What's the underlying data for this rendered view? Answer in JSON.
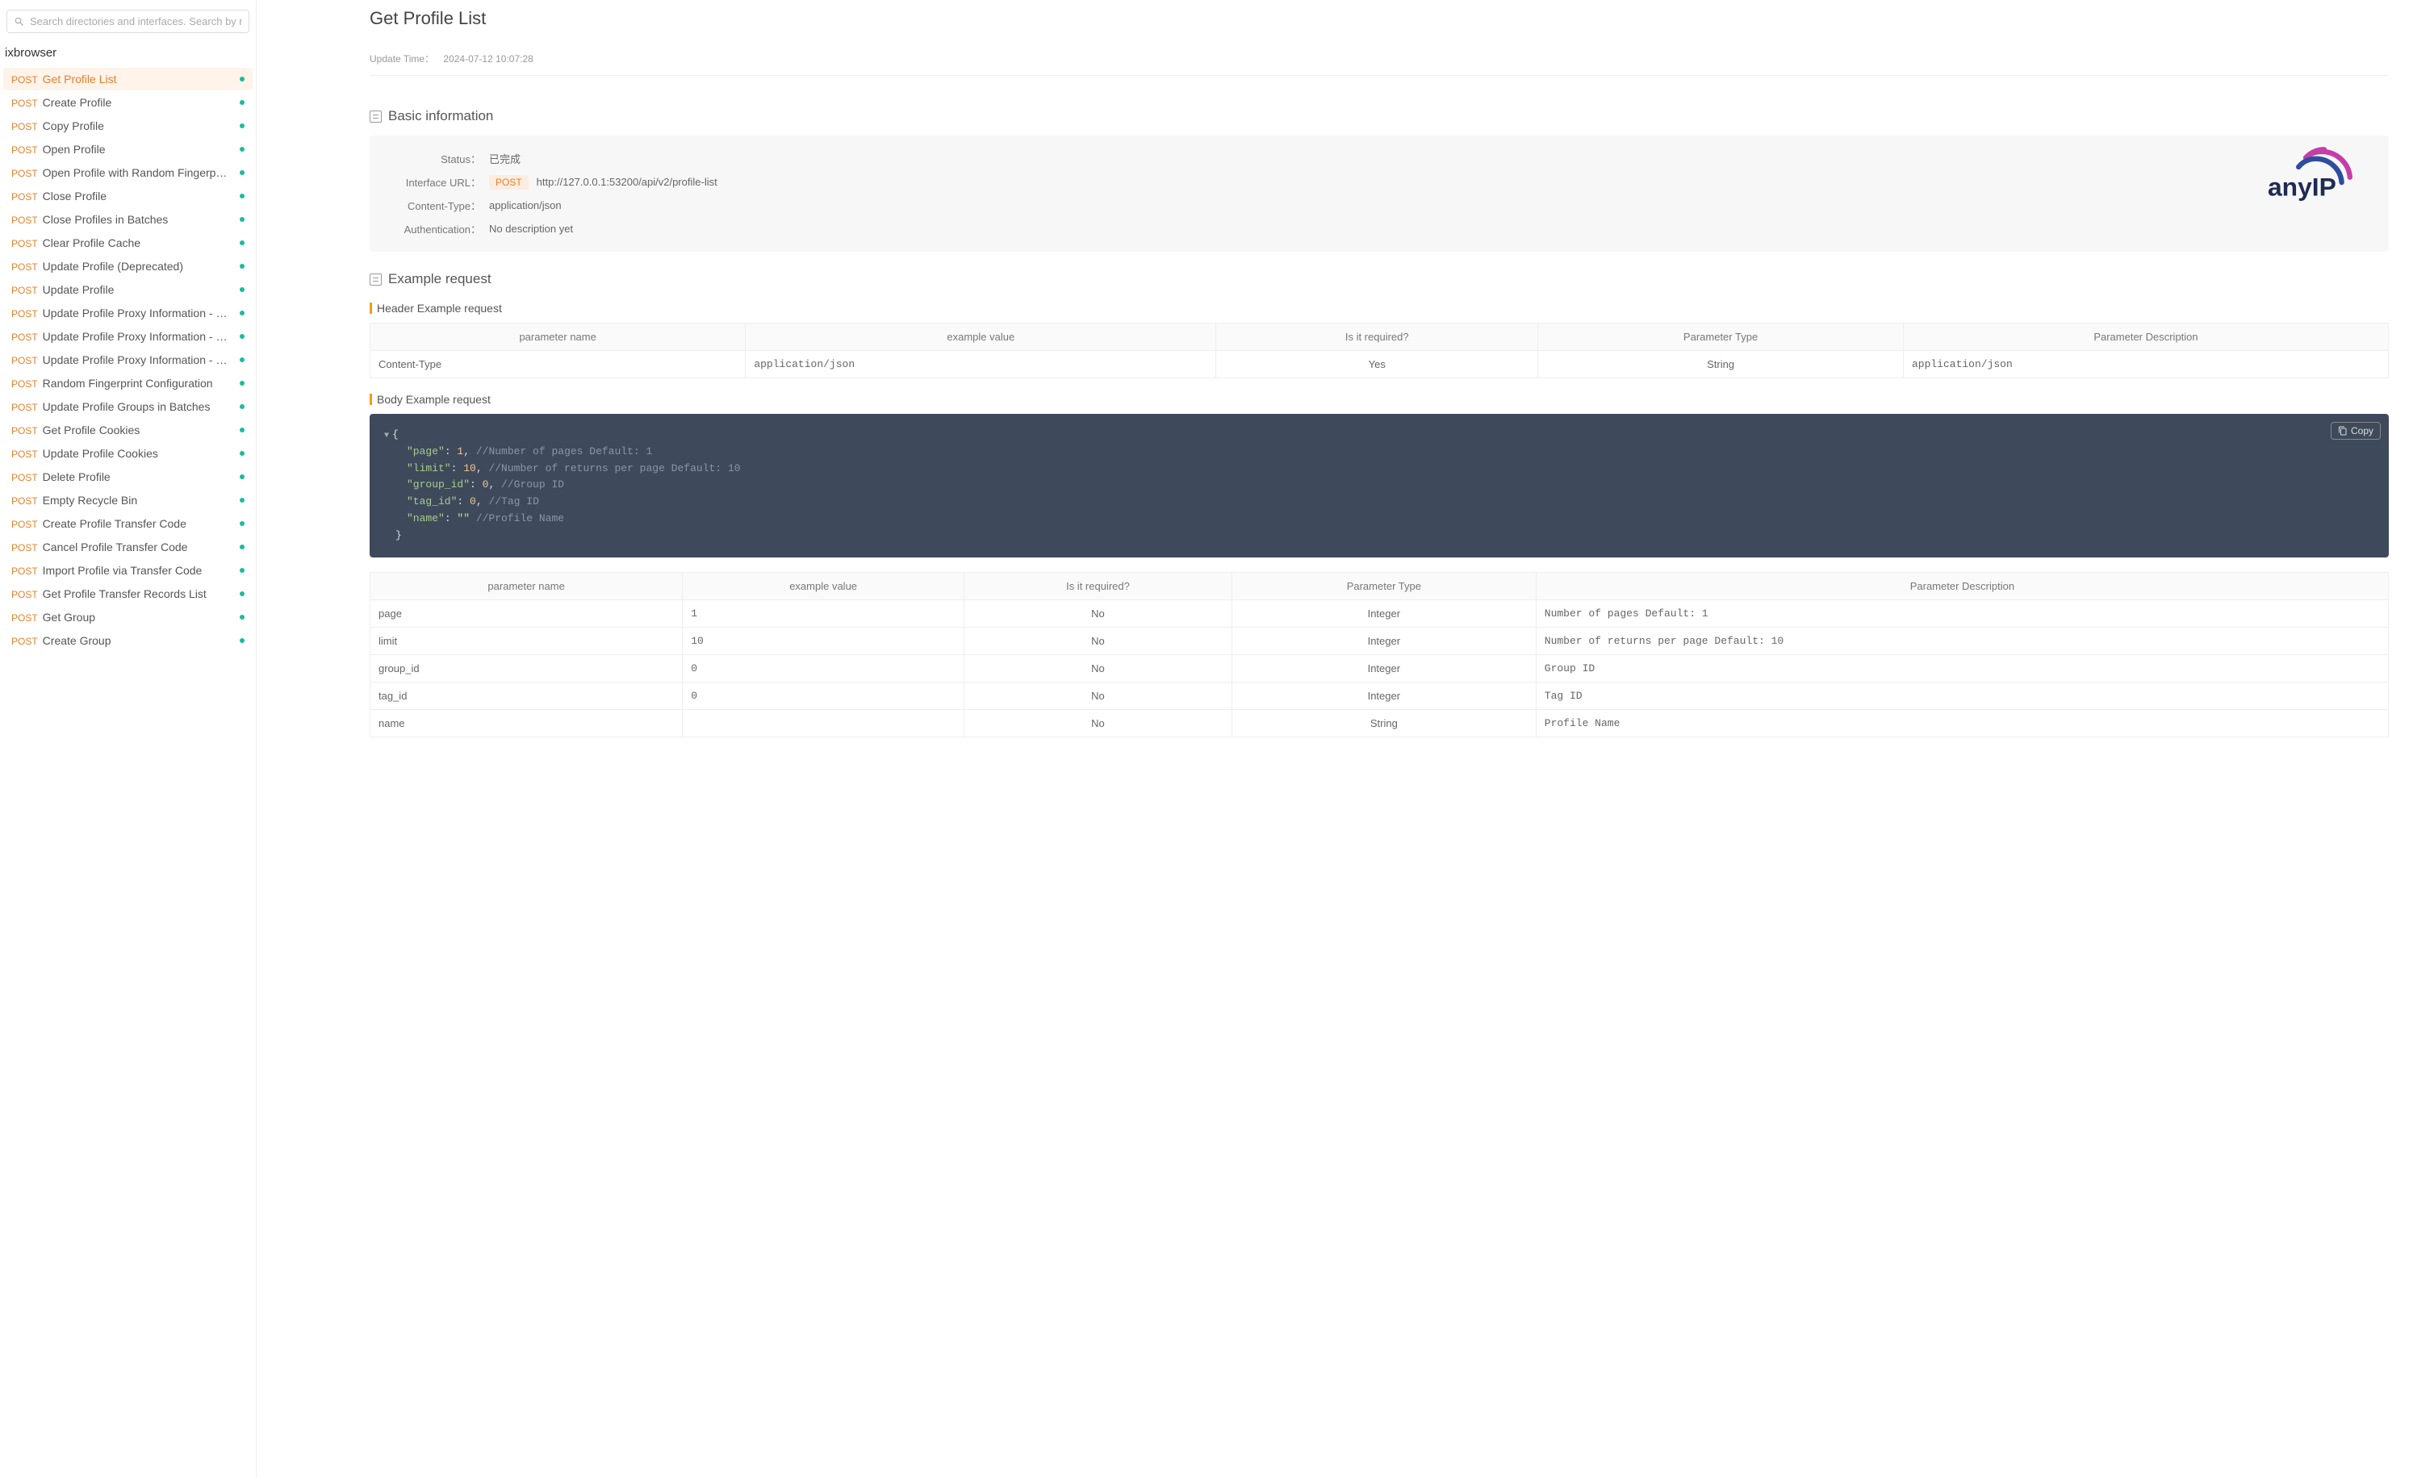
{
  "search": {
    "placeholder": "Search directories and interfaces. Search by name"
  },
  "brand": "ixbrowser",
  "nav": [
    {
      "method": "POST",
      "label": "Get Profile List",
      "active": true
    },
    {
      "method": "POST",
      "label": "Create Profile"
    },
    {
      "method": "POST",
      "label": "Copy Profile"
    },
    {
      "method": "POST",
      "label": "Open Profile"
    },
    {
      "method": "POST",
      "label": "Open Profile with Random Fingerprint Co…"
    },
    {
      "method": "POST",
      "label": "Close Profile"
    },
    {
      "method": "POST",
      "label": "Close Profiles in Batches"
    },
    {
      "method": "POST",
      "label": "Clear Profile Cache"
    },
    {
      "method": "POST",
      "label": "Update Profile (Deprecated)"
    },
    {
      "method": "POST",
      "label": "Update Profile"
    },
    {
      "method": "POST",
      "label": "Update Profile Proxy Information - Purch…"
    },
    {
      "method": "POST",
      "label": "Update Profile Proxy Information - Purch…"
    },
    {
      "method": "POST",
      "label": "Update Profile Proxy Information - Custo…"
    },
    {
      "method": "POST",
      "label": "Random Fingerprint Configuration"
    },
    {
      "method": "POST",
      "label": "Update Profile Groups in Batches"
    },
    {
      "method": "POST",
      "label": "Get Profile Cookies"
    },
    {
      "method": "POST",
      "label": "Update Profile Cookies"
    },
    {
      "method": "POST",
      "label": "Delete Profile"
    },
    {
      "method": "POST",
      "label": "Empty Recycle Bin"
    },
    {
      "method": "POST",
      "label": "Create Profile Transfer Code"
    },
    {
      "method": "POST",
      "label": "Cancel Profile Transfer Code"
    },
    {
      "method": "POST",
      "label": "Import Profile via Transfer Code"
    },
    {
      "method": "POST",
      "label": "Get Profile Transfer Records List"
    },
    {
      "method": "POST",
      "label": "Get Group"
    },
    {
      "method": "POST",
      "label": "Create Group"
    }
  ],
  "page": {
    "title": "Get Profile List",
    "updateLabel": "Update Time：",
    "updateTime": "2024-07-12 10:07:28"
  },
  "sections": {
    "basic": "Basic information",
    "exampleReq": "Example request",
    "headerReq": "Header Example request",
    "bodyReq": "Body Example request"
  },
  "basic": {
    "statusLabel": "Status：",
    "statusValue": "已完成",
    "urlLabel": "Interface URL：",
    "methodBadge": "POST",
    "url": "http://127.0.0.1:53200/api/v2/profile-list",
    "ctLabel": "Content-Type：",
    "ctValue": "application/json",
    "authLabel": "Authentication：",
    "authValue": "No description yet"
  },
  "logoText": "anyIP",
  "headerTable": {
    "cols": [
      "parameter name",
      "example value",
      "Is it required?",
      "Parameter Type",
      "Parameter Description"
    ],
    "rows": [
      {
        "name": "Content-Type",
        "example": "application/json",
        "required": "Yes",
        "type": "String",
        "desc": "application/json"
      }
    ]
  },
  "code": {
    "copy": "Copy",
    "lines": [
      {
        "key": "\"page\"",
        "val": "1",
        "valClass": "tok-num",
        "comma": ",",
        "comment": " //Number of pages Default: 1"
      },
      {
        "key": "\"limit\"",
        "val": "10",
        "valClass": "tok-num",
        "comma": ",",
        "comment": " //Number of returns per page Default: 10"
      },
      {
        "key": "\"group_id\"",
        "val": "0",
        "valClass": "tok-num",
        "comma": ",",
        "comment": " //Group ID"
      },
      {
        "key": "\"tag_id\"",
        "val": "0",
        "valClass": "tok-num",
        "comma": ",",
        "comment": " //Tag ID"
      },
      {
        "key": "\"name\"",
        "val": "\"\"",
        "valClass": "tok-str",
        "comma": "",
        "comment": " //Profile Name"
      }
    ]
  },
  "bodyTable": {
    "cols": [
      "parameter name",
      "example value",
      "Is it required?",
      "Parameter Type",
      "Parameter Description"
    ],
    "rows": [
      {
        "name": "page",
        "example": "1",
        "required": "No",
        "type": "Integer",
        "desc": "Number of pages Default: 1"
      },
      {
        "name": "limit",
        "example": "10",
        "required": "No",
        "type": "Integer",
        "desc": "Number of returns per page Default: 10"
      },
      {
        "name": "group_id",
        "example": "0",
        "required": "No",
        "type": "Integer",
        "desc": "Group ID"
      },
      {
        "name": "tag_id",
        "example": "0",
        "required": "No",
        "type": "Integer",
        "desc": "Tag ID"
      },
      {
        "name": "name",
        "example": "",
        "required": "No",
        "type": "String",
        "desc": "Profile Name"
      }
    ]
  }
}
